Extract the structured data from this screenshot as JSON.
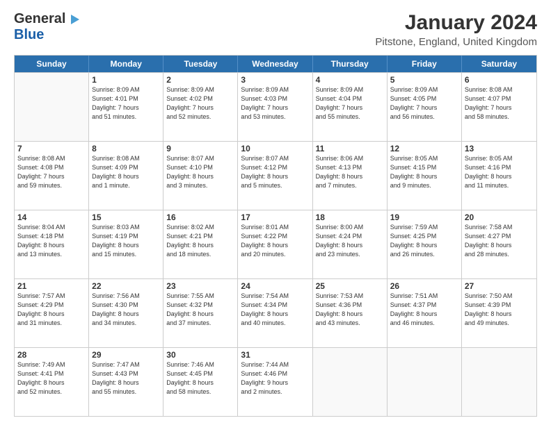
{
  "logo": {
    "general": "General",
    "blue": "Blue"
  },
  "title": "January 2024",
  "location": "Pitstone, England, United Kingdom",
  "weekdays": [
    "Sunday",
    "Monday",
    "Tuesday",
    "Wednesday",
    "Thursday",
    "Friday",
    "Saturday"
  ],
  "weeks": [
    [
      {
        "day": "",
        "info": ""
      },
      {
        "day": "1",
        "info": "Sunrise: 8:09 AM\nSunset: 4:01 PM\nDaylight: 7 hours\nand 51 minutes."
      },
      {
        "day": "2",
        "info": "Sunrise: 8:09 AM\nSunset: 4:02 PM\nDaylight: 7 hours\nand 52 minutes."
      },
      {
        "day": "3",
        "info": "Sunrise: 8:09 AM\nSunset: 4:03 PM\nDaylight: 7 hours\nand 53 minutes."
      },
      {
        "day": "4",
        "info": "Sunrise: 8:09 AM\nSunset: 4:04 PM\nDaylight: 7 hours\nand 55 minutes."
      },
      {
        "day": "5",
        "info": "Sunrise: 8:09 AM\nSunset: 4:05 PM\nDaylight: 7 hours\nand 56 minutes."
      },
      {
        "day": "6",
        "info": "Sunrise: 8:08 AM\nSunset: 4:07 PM\nDaylight: 7 hours\nand 58 minutes."
      }
    ],
    [
      {
        "day": "7",
        "info": "Sunrise: 8:08 AM\nSunset: 4:08 PM\nDaylight: 7 hours\nand 59 minutes."
      },
      {
        "day": "8",
        "info": "Sunrise: 8:08 AM\nSunset: 4:09 PM\nDaylight: 8 hours\nand 1 minute."
      },
      {
        "day": "9",
        "info": "Sunrise: 8:07 AM\nSunset: 4:10 PM\nDaylight: 8 hours\nand 3 minutes."
      },
      {
        "day": "10",
        "info": "Sunrise: 8:07 AM\nSunset: 4:12 PM\nDaylight: 8 hours\nand 5 minutes."
      },
      {
        "day": "11",
        "info": "Sunrise: 8:06 AM\nSunset: 4:13 PM\nDaylight: 8 hours\nand 7 minutes."
      },
      {
        "day": "12",
        "info": "Sunrise: 8:05 AM\nSunset: 4:15 PM\nDaylight: 8 hours\nand 9 minutes."
      },
      {
        "day": "13",
        "info": "Sunrise: 8:05 AM\nSunset: 4:16 PM\nDaylight: 8 hours\nand 11 minutes."
      }
    ],
    [
      {
        "day": "14",
        "info": "Sunrise: 8:04 AM\nSunset: 4:18 PM\nDaylight: 8 hours\nand 13 minutes."
      },
      {
        "day": "15",
        "info": "Sunrise: 8:03 AM\nSunset: 4:19 PM\nDaylight: 8 hours\nand 15 minutes."
      },
      {
        "day": "16",
        "info": "Sunrise: 8:02 AM\nSunset: 4:21 PM\nDaylight: 8 hours\nand 18 minutes."
      },
      {
        "day": "17",
        "info": "Sunrise: 8:01 AM\nSunset: 4:22 PM\nDaylight: 8 hours\nand 20 minutes."
      },
      {
        "day": "18",
        "info": "Sunrise: 8:00 AM\nSunset: 4:24 PM\nDaylight: 8 hours\nand 23 minutes."
      },
      {
        "day": "19",
        "info": "Sunrise: 7:59 AM\nSunset: 4:25 PM\nDaylight: 8 hours\nand 26 minutes."
      },
      {
        "day": "20",
        "info": "Sunrise: 7:58 AM\nSunset: 4:27 PM\nDaylight: 8 hours\nand 28 minutes."
      }
    ],
    [
      {
        "day": "21",
        "info": "Sunrise: 7:57 AM\nSunset: 4:29 PM\nDaylight: 8 hours\nand 31 minutes."
      },
      {
        "day": "22",
        "info": "Sunrise: 7:56 AM\nSunset: 4:30 PM\nDaylight: 8 hours\nand 34 minutes."
      },
      {
        "day": "23",
        "info": "Sunrise: 7:55 AM\nSunset: 4:32 PM\nDaylight: 8 hours\nand 37 minutes."
      },
      {
        "day": "24",
        "info": "Sunrise: 7:54 AM\nSunset: 4:34 PM\nDaylight: 8 hours\nand 40 minutes."
      },
      {
        "day": "25",
        "info": "Sunrise: 7:53 AM\nSunset: 4:36 PM\nDaylight: 8 hours\nand 43 minutes."
      },
      {
        "day": "26",
        "info": "Sunrise: 7:51 AM\nSunset: 4:37 PM\nDaylight: 8 hours\nand 46 minutes."
      },
      {
        "day": "27",
        "info": "Sunrise: 7:50 AM\nSunset: 4:39 PM\nDaylight: 8 hours\nand 49 minutes."
      }
    ],
    [
      {
        "day": "28",
        "info": "Sunrise: 7:49 AM\nSunset: 4:41 PM\nDaylight: 8 hours\nand 52 minutes."
      },
      {
        "day": "29",
        "info": "Sunrise: 7:47 AM\nSunset: 4:43 PM\nDaylight: 8 hours\nand 55 minutes."
      },
      {
        "day": "30",
        "info": "Sunrise: 7:46 AM\nSunset: 4:45 PM\nDaylight: 8 hours\nand 58 minutes."
      },
      {
        "day": "31",
        "info": "Sunrise: 7:44 AM\nSunset: 4:46 PM\nDaylight: 9 hours\nand 2 minutes."
      },
      {
        "day": "",
        "info": ""
      },
      {
        "day": "",
        "info": ""
      },
      {
        "day": "",
        "info": ""
      }
    ]
  ]
}
